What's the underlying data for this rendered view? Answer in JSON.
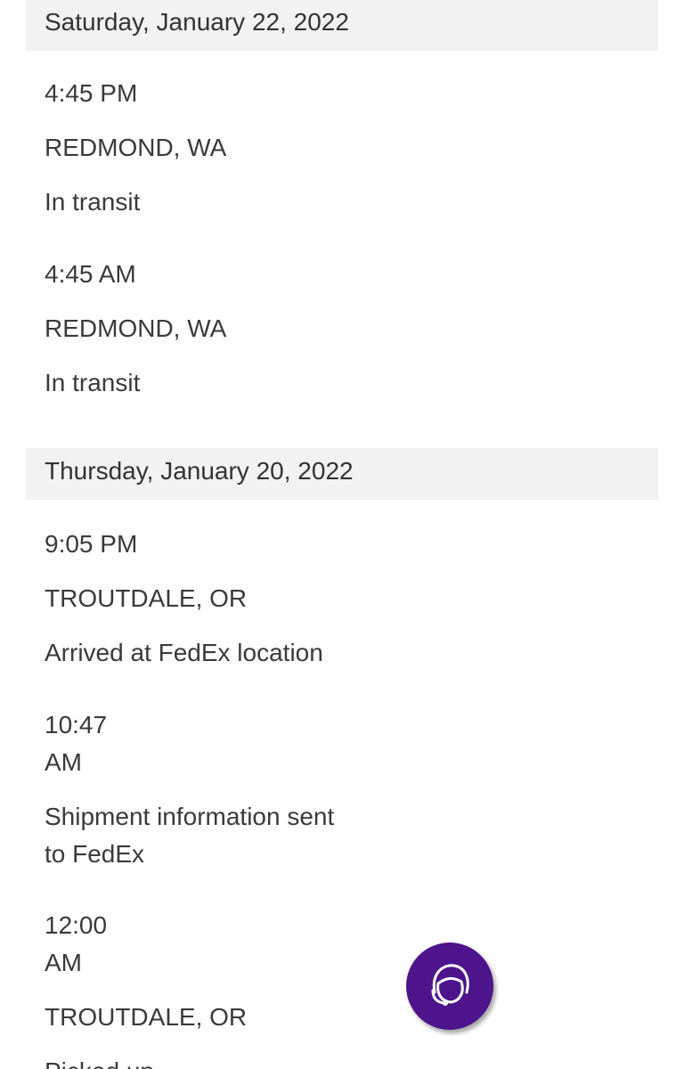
{
  "days": [
    {
      "date": "Saturday, January 22, 2022",
      "events": [
        {
          "time": "4:45 PM",
          "location": "REDMOND, WA",
          "status": "In transit"
        },
        {
          "time": "4:45 AM",
          "location": "REDMOND, WA",
          "status": "In transit"
        }
      ]
    },
    {
      "date": "Thursday, January 20, 2022",
      "events": [
        {
          "time": "9:05 PM",
          "location": "TROUTDALE, OR",
          "status": "Arrived at FedEx location"
        },
        {
          "time_line1": "10:47",
          "time_line2": "AM",
          "status": "Shipment information sent to FedEx"
        },
        {
          "time_line1": "12:00",
          "time_line2": "AM",
          "location": "TROUTDALE, OR",
          "status": "Picked up"
        }
      ]
    }
  ],
  "chat": {
    "icon": "customer-support-agent-icon",
    "color": "#4d148c"
  }
}
